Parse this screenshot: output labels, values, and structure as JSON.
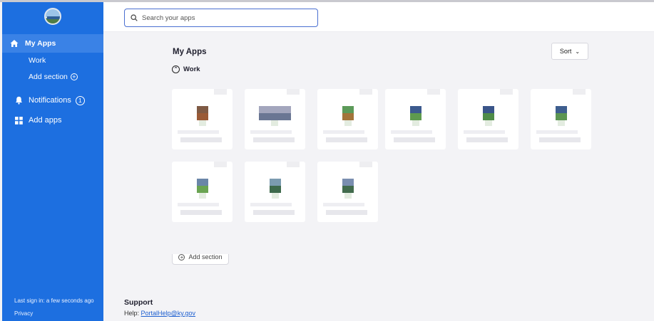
{
  "sidebar": {
    "nav": {
      "my_apps": "My Apps",
      "work": "Work",
      "add_section": "Add section",
      "notifications": "Notifications",
      "notifications_count": "1",
      "add_apps": "Add apps"
    },
    "footer": {
      "last_sign_in": "Last sign in: a few seconds ago",
      "privacy": "Privacy"
    }
  },
  "search": {
    "placeholder": "Search your apps",
    "value": ""
  },
  "main": {
    "title": "My Apps",
    "sort_label": "Sort",
    "section_title": "Work",
    "add_section_label": "Add section",
    "app_count": 9
  },
  "support": {
    "title": "Support",
    "help_label": "Help:",
    "help_email": "PortalHelp@ky.gov"
  },
  "colors": {
    "sidebar": "#1d6fe0",
    "sidebar_active": "#3a82e6",
    "search_border": "#4a6fd1",
    "background": "#f3f3f6",
    "link": "#1d5fd0"
  }
}
